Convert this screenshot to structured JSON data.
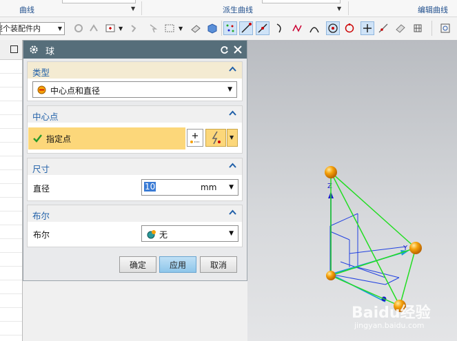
{
  "ribbon": {
    "group_curve": "曲线",
    "group_derived": "派生曲线",
    "group_edit": "编辑曲线"
  },
  "toolbar": {
    "filter_value": "整个装配件内"
  },
  "dialog": {
    "title": "球",
    "sections": {
      "type": {
        "title": "类型",
        "value": "中心点和直径"
      },
      "center": {
        "title": "中心点",
        "specify_point": "指定点"
      },
      "dimension": {
        "title": "尺寸",
        "diameter_label": "直径",
        "diameter_value": "10",
        "unit": "mm"
      },
      "boolean": {
        "title": "布尔",
        "boolean_label": "布尔",
        "boolean_value": "无"
      }
    },
    "buttons": {
      "ok": "确定",
      "apply": "应用",
      "cancel": "取消"
    }
  },
  "viewport": {
    "axis_z": "Z",
    "axis_y": "Y"
  },
  "watermark": {
    "brand": "Baidu经验",
    "url": "jingyan.baidu.com"
  },
  "colors": {
    "dialog_title_bg": "#566e7a",
    "section_header_bg": "#f4ebd2",
    "section_title": "#1f5fa8",
    "specify_point_bg": "#fcd77a",
    "sphere": "#f5a10a",
    "edge": "#22dd22",
    "wire": "#2040e0"
  }
}
